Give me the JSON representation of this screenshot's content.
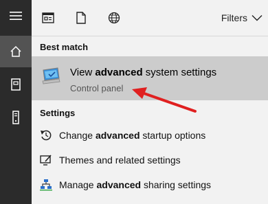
{
  "rail": {
    "items": [
      {
        "icon": "hamburger-menu-icon"
      },
      {
        "icon": "home-icon"
      },
      {
        "icon": "notebook-icon"
      },
      {
        "icon": "tower-icon"
      }
    ]
  },
  "toolbar": {
    "icons": [
      "apps-icon",
      "documents-icon",
      "web-icon"
    ],
    "filters_label": "Filters"
  },
  "best_match": {
    "header": "Best match",
    "title_pre": "View ",
    "title_bold": "advanced",
    "title_post": " system settings",
    "subtitle": "Control panel"
  },
  "settings": {
    "header": "Settings",
    "items": [
      {
        "pre": "Change ",
        "bold": "advanced",
        "post": " startup options",
        "icon": "restart-icon"
      },
      {
        "pre": "Themes and related settings",
        "bold": "",
        "post": "",
        "icon": "themes-icon"
      },
      {
        "pre": "Manage ",
        "bold": "advanced",
        "post": " sharing settings",
        "icon": "network-sharing-icon"
      }
    ]
  },
  "colors": {
    "rail_bg": "#2b2b2b",
    "rail_active": "#535353",
    "selected_bg": "#cccccc",
    "arrow": "#e02020"
  }
}
